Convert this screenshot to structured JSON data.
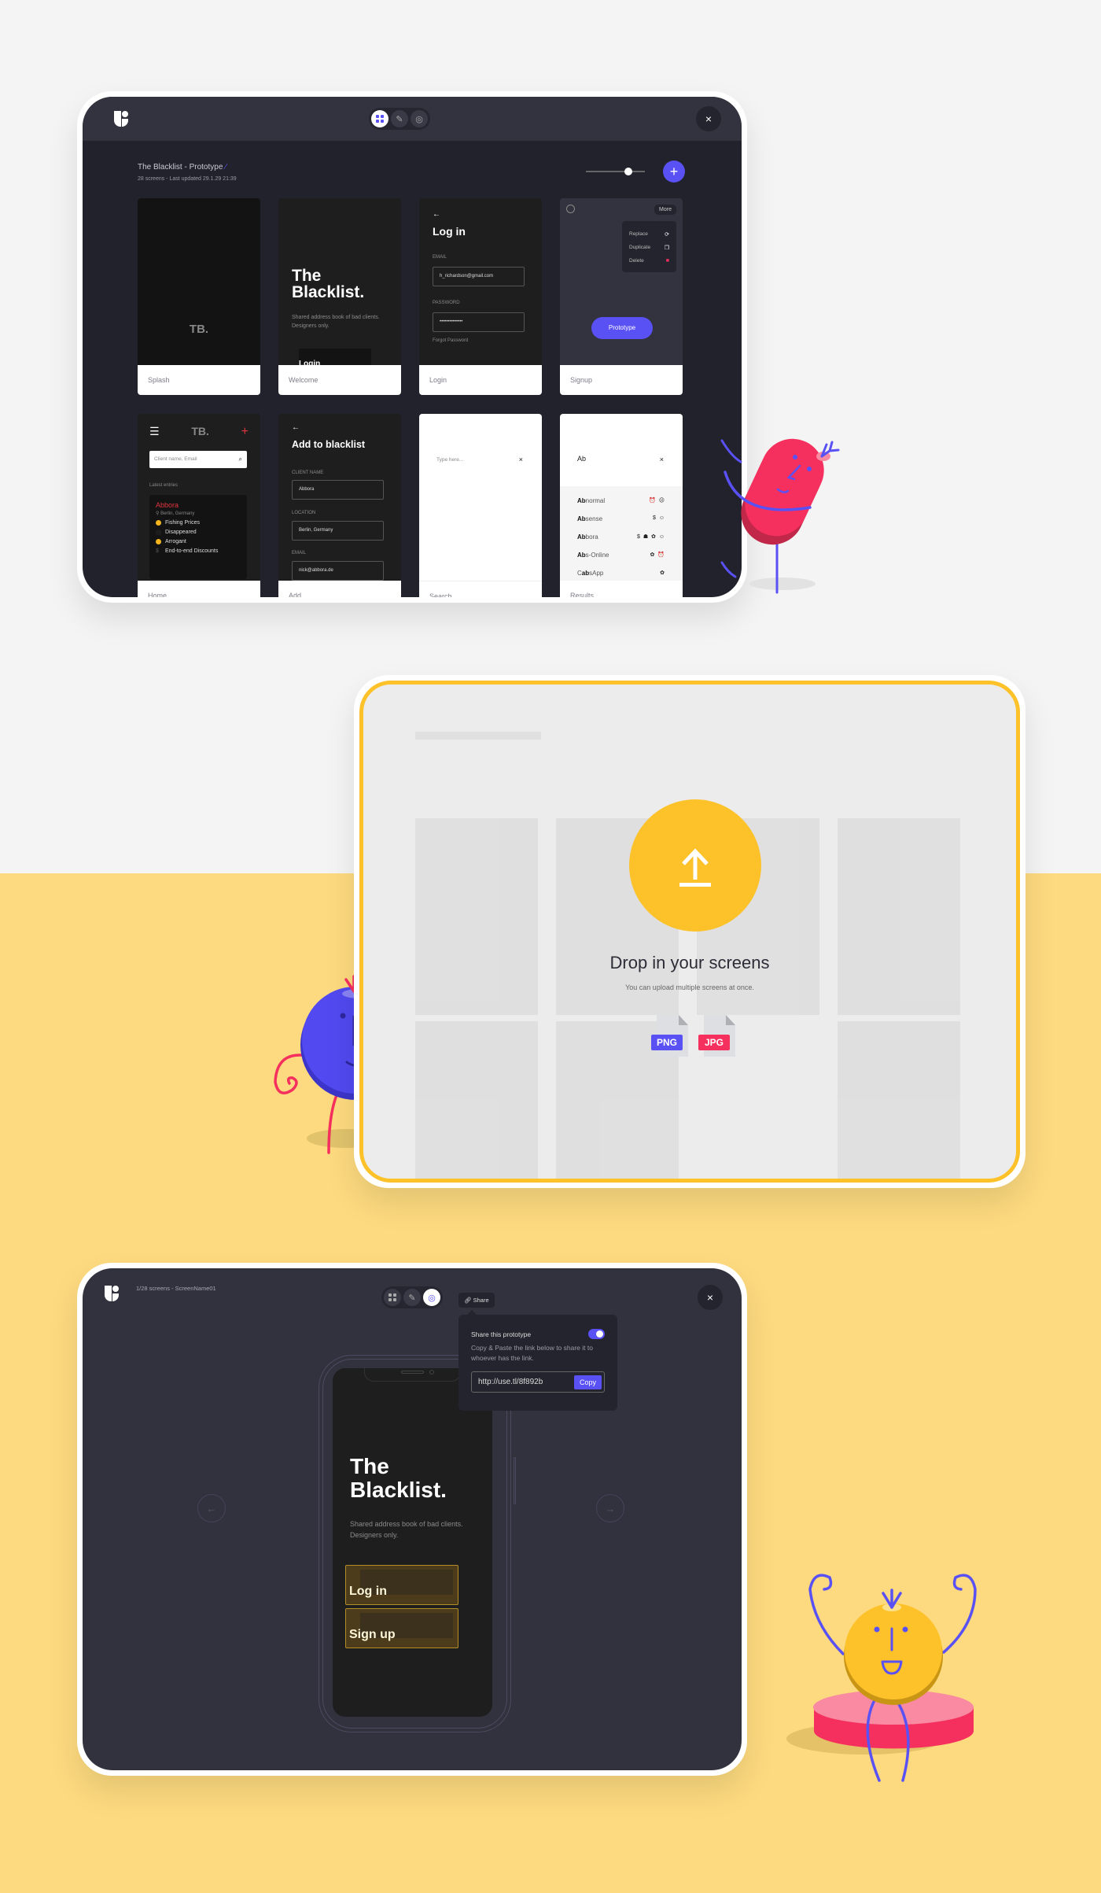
{
  "colors": {
    "accent": "#5a51f5",
    "yellow": "#fdc12a",
    "red": "#f6305e",
    "page_bg": "#f4f4f4",
    "yellow_bg": "#fdda7f"
  },
  "dashboard": {
    "mode_buttons": [
      {
        "icon": "grid-icon",
        "active": true
      },
      {
        "icon": "pencil-icon",
        "active": false
      },
      {
        "icon": "eye-icon",
        "active": false
      }
    ],
    "close_label": "×",
    "project_title": "The Blacklist - Prototype",
    "project_meta": "28 screens - Last updated 29.1.29 21:39",
    "zoom_level": 0.72,
    "add_label": "+",
    "screens": [
      {
        "label": "Splash",
        "logo": "TB."
      },
      {
        "label": "Welcome",
        "heading_line1": "The",
        "heading_line2": "Blacklist.",
        "tagline": "Shared address book of bad clients. Designers only.",
        "button_peek": "Login"
      },
      {
        "label": "Login",
        "back": "←",
        "heading": "Log in",
        "email_label": "EMAIL",
        "email_value": "h_richardson@gmail.com",
        "password_label": "PASSWORD",
        "password_value": "••••••••••••••",
        "forgot": "Forgot Password"
      },
      {
        "label": "Signup",
        "more": "More",
        "menu": [
          {
            "label": "Replace",
            "icon": "⟳"
          },
          {
            "label": "Duplicate",
            "icon": "❐"
          },
          {
            "label": "Delete",
            "icon": "■"
          }
        ],
        "prototype_button": "Prototype"
      },
      {
        "label": "Home",
        "menu_icon": "☰",
        "logo": "TB.",
        "plus": "+",
        "search_placeholder": "Client name, Email",
        "search_icon": "⌕",
        "latest_label": "Latest entries",
        "entry": {
          "name": "Abbora",
          "location": "Berlin, Germany",
          "tags": [
            "Fishing Prices",
            "Disappeared",
            "Arrogant",
            "End-to-end Discounts"
          ]
        }
      },
      {
        "label": "Add",
        "back": "←",
        "heading": "Add to blacklist",
        "fields": [
          {
            "label": "CLIENT NAME",
            "value": "Abbora"
          },
          {
            "label": "LOCATION",
            "value": "Berlin, Germany"
          },
          {
            "label": "EMAIL",
            "value": "nick@abbora.de"
          }
        ]
      },
      {
        "label": "Search",
        "placeholder": "Type here...",
        "clear": "×"
      },
      {
        "label": "Results",
        "query": "Ab",
        "clear": "×",
        "results": [
          {
            "pre": "",
            "match": "Ab",
            "rest": "normal",
            "tags": "⏰ ☹"
          },
          {
            "pre": "",
            "match": "Ab",
            "rest": "sense",
            "tags": "$ ☺"
          },
          {
            "pre": "",
            "match": "Ab",
            "rest": "bora",
            "tags": "$ ☗ ✿ ☺"
          },
          {
            "pre": "",
            "match": "Ab",
            "rest": "s-Online",
            "tags": "✿ ⏰"
          },
          {
            "pre": "C",
            "match": "ab",
            "rest": "sApp",
            "tags": "✿"
          }
        ]
      }
    ]
  },
  "dropzone": {
    "heading": "Drop in your screens",
    "subtext": "You can upload multiple screens at once.",
    "file_types": [
      {
        "label": "PNG",
        "color": "#5a51f5"
      },
      {
        "label": "JPG",
        "color": "#f6305e"
      }
    ]
  },
  "preview": {
    "screens_count": "1/28 screens - ScreenName01",
    "share_chip": "Share",
    "share_popover": {
      "title": "Share this prototype",
      "enabled": true,
      "description": "Copy & Paste the link below to share it to whoever has the link.",
      "link": "http://use.tl/8f892b",
      "copy_label": "Copy"
    },
    "phone": {
      "heading_line1": "The",
      "heading_line2": "Blacklist.",
      "tagline_line1": "Shared address book of bad clients.",
      "tagline_line2": "Designers only.",
      "hotspots": [
        "Log in",
        "Sign up"
      ]
    },
    "prev_arrow": "←",
    "next_arrow": "→",
    "close_label": "×"
  }
}
